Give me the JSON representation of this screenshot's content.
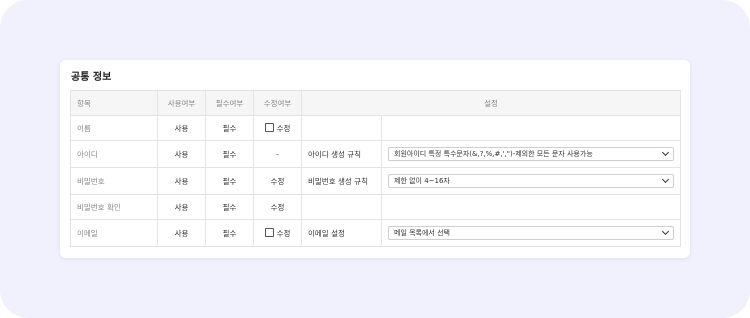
{
  "section_title": "공통 정보",
  "headers": {
    "item": "항목",
    "use": "사용여부",
    "required": "필수여부",
    "edit": "수정여부",
    "setting": "설정"
  },
  "rows": [
    {
      "item": "이름",
      "use": "사용",
      "required": "필수",
      "edit": "수정",
      "edit_has_checkbox": true,
      "setting_label": "",
      "setting_value": ""
    },
    {
      "item": "아이디",
      "use": "사용",
      "required": "필수",
      "edit": "-",
      "edit_has_checkbox": false,
      "setting_label": "아이디 생성 규칙",
      "setting_value": "회원아이디 특정 특수문자(&,?,%,#,',\")-제외한 모든 문자 사용가능"
    },
    {
      "item": "비밀번호",
      "use": "사용",
      "required": "필수",
      "edit": "수정",
      "edit_has_checkbox": false,
      "setting_label": "비밀번호 생성 규칙",
      "setting_value": "제한 없이 4~16자"
    },
    {
      "item": "비밀번호 확인",
      "use": "사용",
      "required": "필수",
      "edit": "수정",
      "edit_has_checkbox": false,
      "setting_label": "",
      "setting_value": ""
    },
    {
      "item": "이메일",
      "use": "사용",
      "required": "필수",
      "edit": "수정",
      "edit_has_checkbox": true,
      "setting_label": "이메일 설정",
      "setting_value": "메일 목록에서 선택"
    }
  ],
  "icons": {
    "checkbox": "checkbox-unchecked-icon",
    "dropdown": "chevron-down-icon"
  },
  "colors": {
    "page_background": "#f1f0fd",
    "card_background": "#ffffff",
    "header_background": "#f6f6f6",
    "border": "#e3e3e3"
  }
}
